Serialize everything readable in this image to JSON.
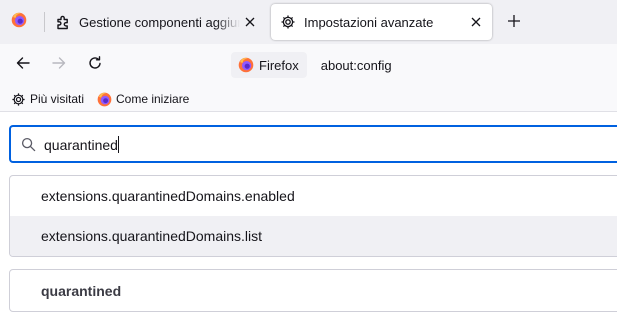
{
  "tabs": [
    {
      "label": "Gestione componenti aggiuntivi",
      "icon": "puzzle-icon",
      "active": false
    },
    {
      "label": "Impostazioni avanzate",
      "icon": "gear-icon",
      "active": true
    }
  ],
  "urlbar": {
    "identity_label": "Firefox",
    "url": "about:config"
  },
  "bookmarks": [
    {
      "label": "Più visitati",
      "icon": "gear-icon"
    },
    {
      "label": "Come iniziare",
      "icon": "firefox-icon"
    }
  ],
  "search": {
    "value": "quarantined",
    "icon": "search-icon"
  },
  "preferences": [
    {
      "name": "extensions.quarantinedDomains.enabled"
    },
    {
      "name": "extensions.quarantinedDomains.list"
    }
  ],
  "new_preference": {
    "name": "quarantined"
  },
  "colors": {
    "accent": "#0061e0",
    "tabstrip": "#f0f0f4",
    "toolbar": "#f9f9fb",
    "row_alt": "#f0f0f4"
  }
}
